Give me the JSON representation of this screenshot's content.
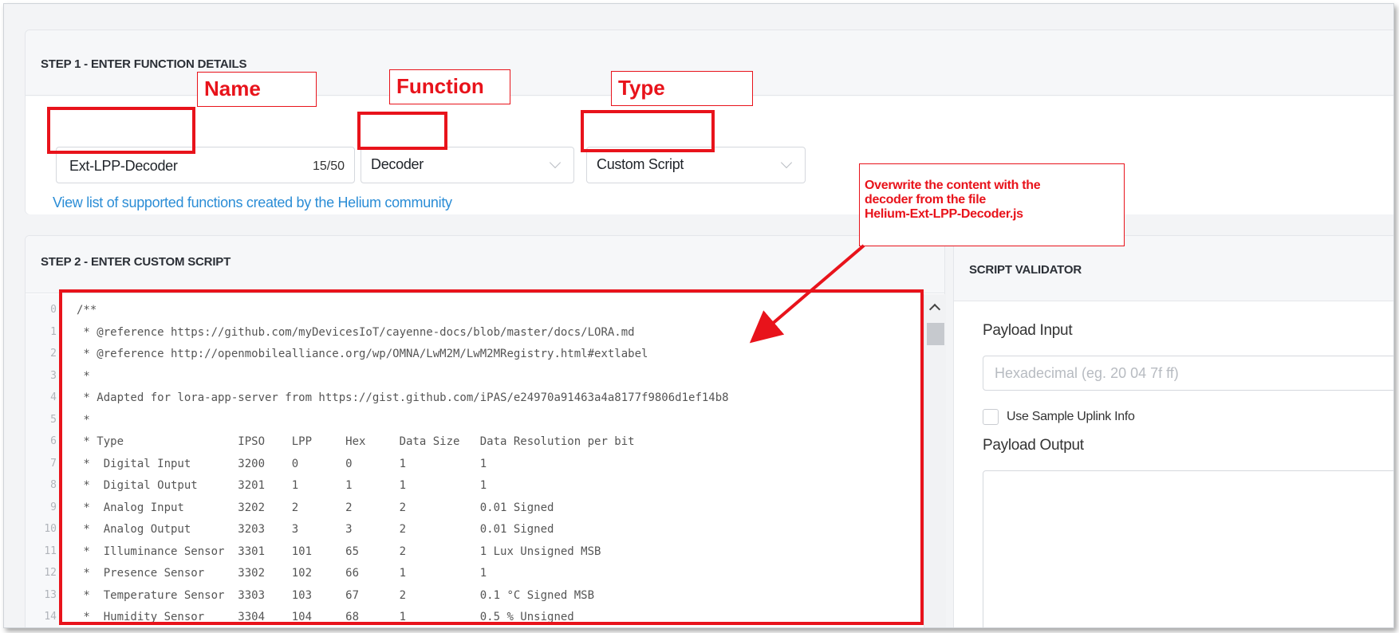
{
  "step1": {
    "title": "STEP 1 - ENTER FUNCTION DETAILS",
    "name_value": "Ext-LPP-Decoder",
    "name_count": "15/50",
    "function_value": "Decoder",
    "type_value": "Custom Script",
    "community_link": "View list of supported functions created by the Helium community"
  },
  "step2": {
    "title": "STEP 2 - ENTER CUSTOM SCRIPT",
    "lines": [
      {
        "n": "0",
        "code": "/**"
      },
      {
        "n": "1",
        "code": " * @reference https://github.com/myDevicesIoT/cayenne-docs/blob/master/docs/LORA.md"
      },
      {
        "n": "2",
        "code": " * @reference http://openmobilealliance.org/wp/OMNA/LwM2M/LwM2MRegistry.html#extlabel"
      },
      {
        "n": "3",
        "code": " *"
      },
      {
        "n": "4",
        "code": " * Adapted for lora-app-server from https://gist.github.com/iPAS/e24970a91463a4a8177f9806d1ef14b8"
      },
      {
        "n": "5",
        "code": " *"
      },
      {
        "n": "6",
        "code": " * Type                 IPSO    LPP     Hex     Data Size   Data Resolution per bit"
      },
      {
        "n": "7",
        "code": " *  Digital Input       3200    0       0       1           1"
      },
      {
        "n": "8",
        "code": " *  Digital Output      3201    1       1       1           1"
      },
      {
        "n": "9",
        "code": " *  Analog Input        3202    2       2       2           0.01 Signed"
      },
      {
        "n": "10",
        "code": " *  Analog Output       3203    3       3       2           0.01 Signed"
      },
      {
        "n": "11",
        "code": " *  Illuminance Sensor  3301    101     65      2           1 Lux Unsigned MSB"
      },
      {
        "n": "12",
        "code": " *  Presence Sensor     3302    102     66      1           1"
      },
      {
        "n": "13",
        "code": " *  Temperature Sensor  3303    103     67      2           0.1 °C Signed MSB"
      },
      {
        "n": "14",
        "code": " *  Humidity Sensor     3304    104     68      1           0.5 % Unsigned"
      }
    ]
  },
  "validator": {
    "title": "SCRIPT VALIDATOR",
    "payload_input_label": "Payload Input",
    "payload_input_placeholder": "Hexadecimal (eg. 20 04 7f ff)",
    "sample_uplink_label": "Use Sample Uplink Info",
    "payload_output_label": "Payload Output"
  },
  "annotations": {
    "name_tag": "Name",
    "function_tag": "Function",
    "type_tag": "Type",
    "note_line1": "Overwrite the content with the",
    "note_line2": "decoder from the file",
    "note_line3": "Helium-Ext-LPP-Decoder.js",
    "highlight_color": "#e8131b"
  },
  "colors": {
    "link": "#2b8dd6",
    "card_header": "#f6f7f9",
    "background": "#f3f4f6"
  }
}
